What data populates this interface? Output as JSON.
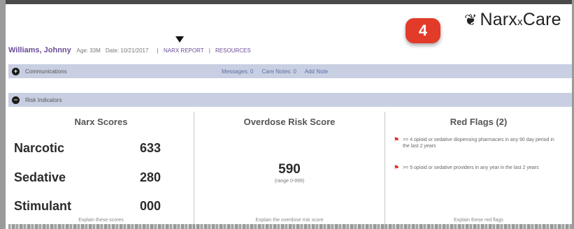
{
  "logo": {
    "text_main": "Narx",
    "text_sub": "x",
    "text_end": "Care",
    "mark_glyph": "❦"
  },
  "badge": {
    "number": "4",
    "color": "#e23b2a"
  },
  "patient": {
    "name": "Williams, Johnny",
    "age": "Age: 33M",
    "date": "Date: 10/21/2017",
    "separator": "|",
    "links": [
      "NARX REPORT",
      "RESOURCES"
    ]
  },
  "communications": {
    "icon": "plus-circle-icon",
    "label": "Communications",
    "messages": "Messages: 0",
    "care_notes": "Care Notes: 0",
    "add_note": "Add Note"
  },
  "risk_indicators": {
    "icon": "minus-circle-icon",
    "label": "Risk Indicators"
  },
  "narx_scores": {
    "title": "Narx Scores",
    "rows": [
      {
        "label": "Narcotic",
        "value": "633"
      },
      {
        "label": "Sedative",
        "value": "280"
      },
      {
        "label": "Stimulant",
        "value": "000"
      }
    ],
    "explain": "Explain these scores"
  },
  "overdose": {
    "title": "Overdose Risk Score",
    "value": "590",
    "range": "(range 0-999)",
    "explain": "Explain the overdose risk score"
  },
  "red_flags": {
    "title": "Red Flags (2)",
    "items": [
      ">= 4 opioid or sedative dispensing pharmacies in any 90 day period in the last 2 years",
      ">= 5 opioid or sedative providers in any year in the last 2 years"
    ],
    "explain": "Explain these red flags"
  },
  "colors": {
    "accent_purple": "#6b4b96",
    "bar_bg": "#c9cfe2",
    "flag_red": "#dd2222"
  }
}
